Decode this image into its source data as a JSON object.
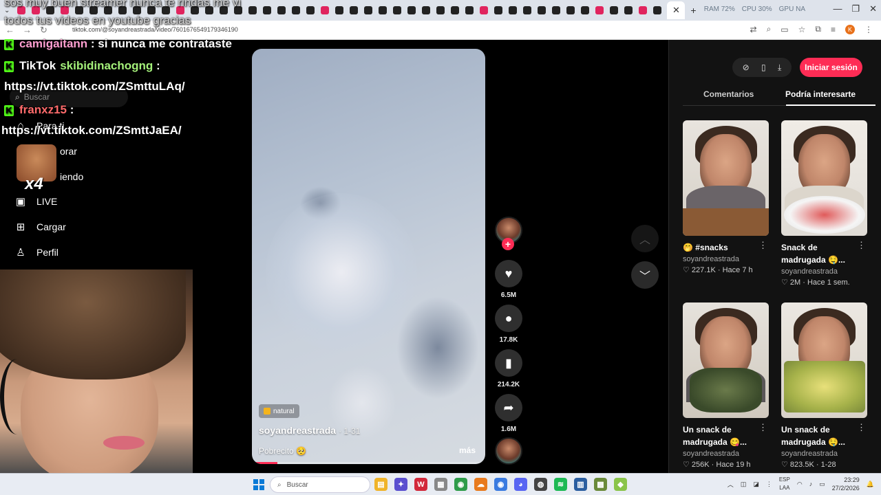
{
  "browser": {
    "url": "tiktok.com/@soyandreastrada/video/7601676549179346190",
    "stats": [
      "RAM 72%",
      "CPU 30%",
      "GPU NA"
    ],
    "profile_initial": "K"
  },
  "overlay": {
    "top_message_line1": "sos muy buen streamer nunca te rindas me vi",
    "top_message_line2": "todos tus videos en youtube gracias",
    "messages": [
      {
        "user": "camigaitann",
        "text": " : si nunca me contrataste"
      },
      {
        "user": "skibidinachogng",
        "text": " :"
      },
      {
        "user": "",
        "text": "https://vt.tiktok.com/ZSmttuLAq/"
      },
      {
        "user": "franxz15",
        "text": " :"
      },
      {
        "user": "",
        "text": "https://vt.tiktok.com/ZSmttJaEA/"
      }
    ],
    "emote_multiplier": "x4"
  },
  "tiktok": {
    "logo_text": "TikTok",
    "search_placeholder": "Buscar",
    "nav": [
      {
        "label": "Para ti",
        "icon": "home-icon"
      },
      {
        "label": "orar",
        "icon": "explore-icon"
      },
      {
        "label": "iendo",
        "icon": "following-icon"
      },
      {
        "label": "LIVE",
        "icon": "live-icon"
      },
      {
        "label": "Cargar",
        "icon": "upload-icon"
      },
      {
        "label": "Perfil",
        "icon": "profile-icon"
      }
    ]
  },
  "video": {
    "tag": "natural",
    "author": "soyandreastrada",
    "date": "· 1-31",
    "caption": "Pobrecito 🥺",
    "more_label": "más",
    "progress": 0.11,
    "likes": "6.5M",
    "comments": "17.8K",
    "saves": "214.2K",
    "shares": "1.6M"
  },
  "right_panel": {
    "login_label": "Iniciar sesión",
    "tabs": [
      "Comentarios",
      "Podría interesarte"
    ],
    "active_tab": 1,
    "cards": [
      {
        "title": "🤭 #snacks",
        "author": "soyandreastrada",
        "likes": "227.1K",
        "age": "Hace 7 h"
      },
      {
        "title": "Snack de madrugada 🤤...",
        "author": "soyandreastrada",
        "likes": "2M",
        "age": "Hace 1 sem."
      },
      {
        "title": "Un snack de madrugada 😋...",
        "author": "soyandreastrada",
        "likes": "256K",
        "age": "Hace 19 h"
      },
      {
        "title": "Un snack de madrugada 🤤...",
        "author": "soyandreastrada",
        "likes": "823.5K",
        "age": "1-28"
      }
    ]
  },
  "taskbar": {
    "search_placeholder": "Buscar",
    "lang": "ESP",
    "lang_sub": "LAA",
    "time": "23:29",
    "date": "27/2/2026"
  },
  "colors": {
    "accent": "#fe2c55",
    "kick_green": "#53fc18"
  }
}
